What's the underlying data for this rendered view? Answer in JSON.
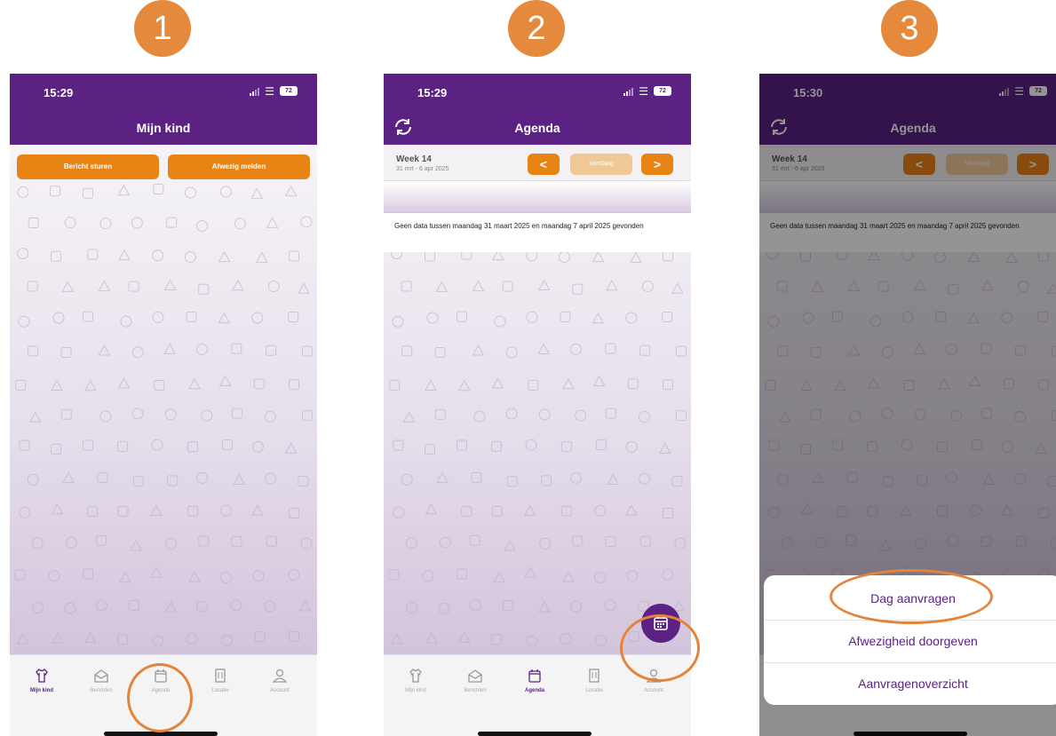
{
  "colors": {
    "purple": "#5b2283",
    "orange": "#e88414",
    "badge_orange": "#e58a3c"
  },
  "steps": [
    "1",
    "2",
    "3"
  ],
  "phone1": {
    "time": "15:29",
    "battery": "72",
    "title": "Mijn kind",
    "buttons": [
      "Bericht sturen",
      "Afwezig melden"
    ],
    "active_tab": 0
  },
  "phone2": {
    "time": "15:29",
    "battery": "72",
    "title": "Agenda",
    "week_label": "Week 14",
    "week_range": "31 mrt - 6 apr 2025",
    "prev_label": "<",
    "today_label": "Vandaag",
    "next_label": ">",
    "no_data": "Geen data tussen maandag 31 maart 2025 en maandag 7 april 2025 gevonden",
    "active_tab": 2,
    "fab_icon": "calendar-icon"
  },
  "phone3": {
    "time": "15:30",
    "battery": "72",
    "title": "Agenda",
    "week_label": "Week 14",
    "week_range": "31 mrt - 6 apr 2025",
    "prev_label": "<",
    "today_label": "Vandaag",
    "next_label": ">",
    "no_data": "Geen data tussen maandag 31 maart 2025 en maandag 7 april 2025 gevonden",
    "sheet_items": [
      "Dag aanvragen",
      "Afwezigheid doorgeven",
      "Aanvragenoverzicht"
    ]
  },
  "tabs": [
    {
      "label": "Mijn kind",
      "icon": "shirt-icon"
    },
    {
      "label": "Berichten",
      "icon": "mail-icon"
    },
    {
      "label": "Agenda",
      "icon": "calendar-icon"
    },
    {
      "label": "Locatie",
      "icon": "building-icon"
    },
    {
      "label": "Account",
      "icon": "person-icon"
    }
  ]
}
